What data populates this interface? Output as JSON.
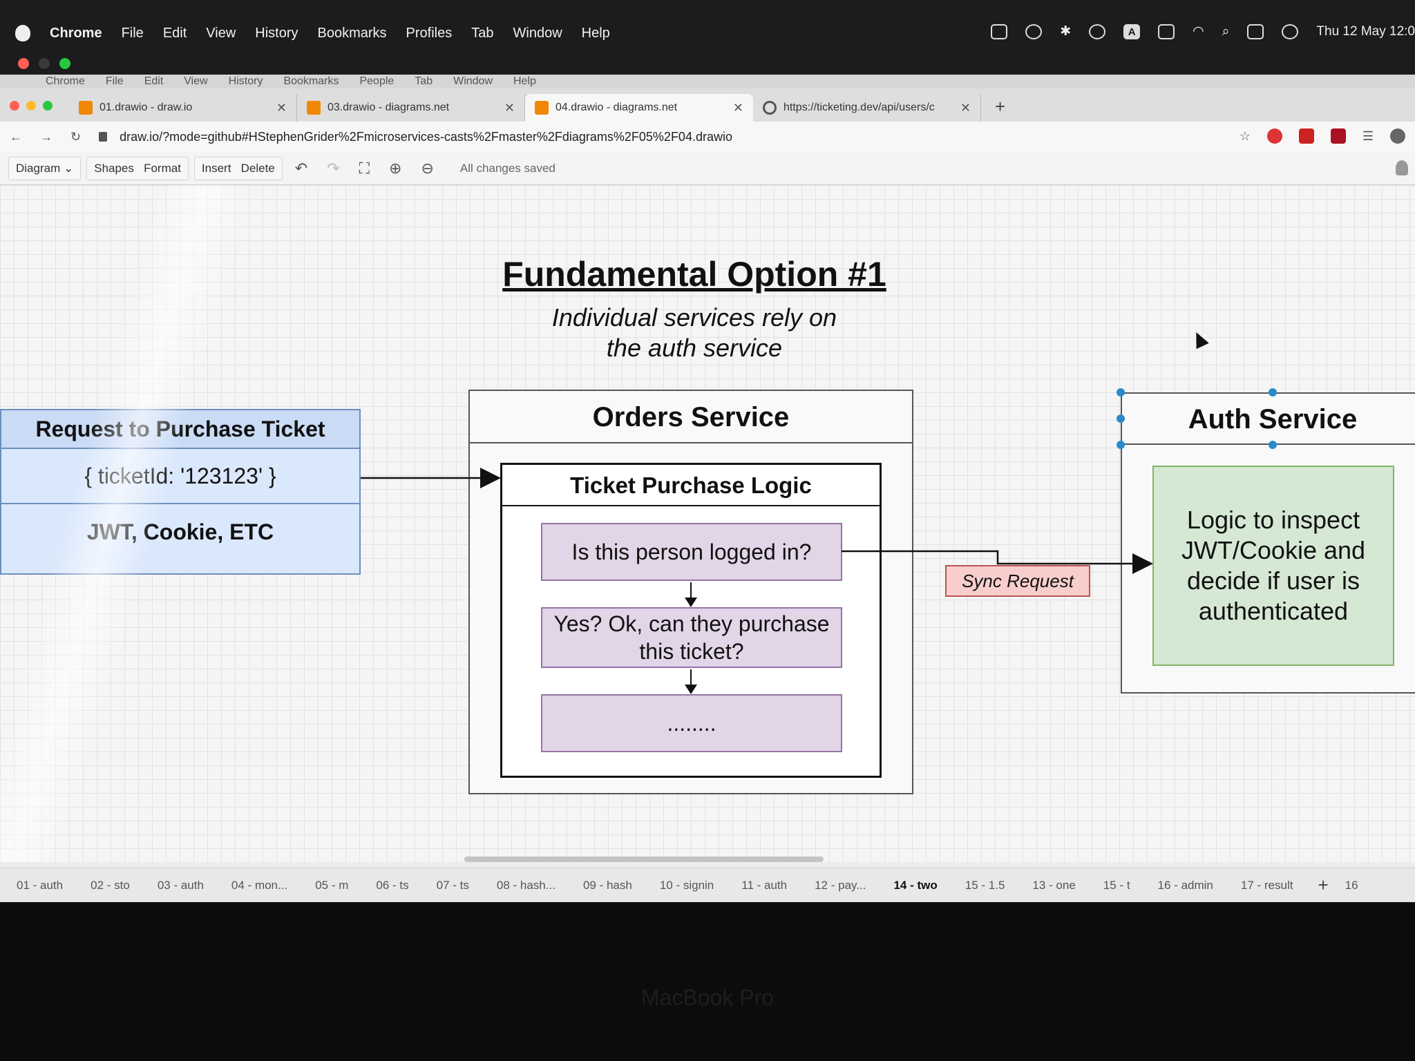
{
  "menubar": {
    "app": "Chrome",
    "items": [
      "File",
      "Edit",
      "View",
      "History",
      "Bookmarks",
      "Profiles",
      "Tab",
      "Window",
      "Help"
    ],
    "clock": "Thu 12 May  12:0",
    "status_icons": [
      "docker-icon",
      "creative-cloud-icon",
      "bluetooth-icon",
      "play-icon",
      "input-source-icon",
      "battery-icon",
      "wifi-icon",
      "spotlight-icon",
      "control-center-icon",
      "siri-icon"
    ],
    "input_letter": "A"
  },
  "ghost_menu": [
    "Chrome",
    "File",
    "Edit",
    "View",
    "History",
    "Bookmarks",
    "People",
    "Tab",
    "Window",
    "Help"
  ],
  "tabs": [
    {
      "title": "01.drawio - draw.io",
      "active": false
    },
    {
      "title": "03.drawio - diagrams.net",
      "active": false
    },
    {
      "title": "04.drawio - diagrams.net",
      "active": true
    },
    {
      "title": "https://ticketing.dev/api/users/c",
      "active": false
    }
  ],
  "address": {
    "url": "draw.io/?mode=github#HStephenGrider%2Fmicroservices-casts%2Fmaster%2Fdiagrams%2F05%2F04.drawio"
  },
  "toolbar": {
    "diagram": "Diagram",
    "shapes": "Shapes",
    "format": "Format",
    "insert": "Insert",
    "delete": "Delete",
    "status": "All changes saved"
  },
  "diagram": {
    "title": "Fundamental Option #1",
    "subtitle_line1": "Individual services rely on",
    "subtitle_line2": "the auth service",
    "request": {
      "header": "Request to Purchase Ticket",
      "body": "{ ticketId: '123123' }",
      "footer": "JWT, Cookie, ETC"
    },
    "orders": {
      "header": "Orders Service",
      "logic_header": "Ticket Purchase Logic",
      "step1": "Is this person logged in?",
      "step2": "Yes? Ok, can they purchase this ticket?",
      "step3": "........"
    },
    "sync_label": "Sync Request",
    "auth": {
      "header": "Auth Service",
      "body": "Logic to inspect JWT/Cookie and decide if user is authenticated"
    }
  },
  "pages": [
    "01 - auth",
    "02 - sto",
    "03 - auth",
    "04 - mon...",
    "05 - m",
    "06 - ts",
    "07 - ts",
    "08 - hash...",
    "09 - hash",
    "10 - signin",
    "11 - auth",
    "12 - pay...",
    "14 - two",
    "15 - 1.5",
    "13 - one",
    "15 - t",
    "16 - admin",
    "17 - result",
    "16"
  ],
  "active_page": "14 - two",
  "bezel_brand": "MacBook Pro",
  "colors": {
    "request_fill": "#dae8fc",
    "step_fill": "#e1d5e7",
    "sync_fill": "#f8cecc",
    "auth_fill": "#d5e8d4",
    "selection": "#2a8acb"
  }
}
